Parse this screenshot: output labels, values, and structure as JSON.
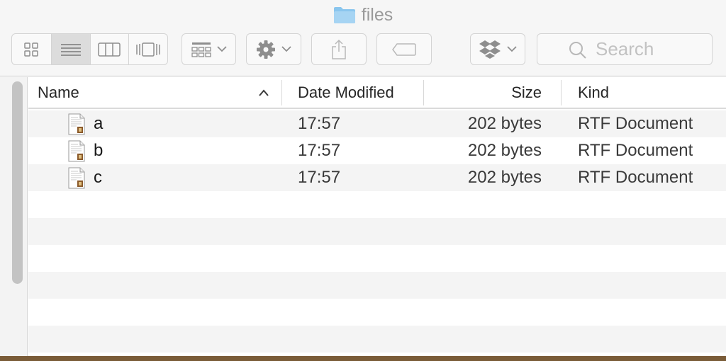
{
  "window": {
    "title": "files"
  },
  "toolbar": {
    "view_modes": [
      "icon-view",
      "list-view",
      "column-view",
      "cover-flow-view"
    ],
    "active_view": "list-view",
    "search_placeholder": "Search"
  },
  "columns": {
    "name": "Name",
    "date": "Date Modified",
    "size": "Size",
    "kind": "Kind",
    "sort_indicator": "^"
  },
  "files": [
    {
      "name": "a",
      "date": "17:57",
      "size": "202 bytes",
      "kind": "RTF Document"
    },
    {
      "name": "b",
      "date": "17:57",
      "size": "202 bytes",
      "kind": "RTF Document"
    },
    {
      "name": "c",
      "date": "17:57",
      "size": "202 bytes",
      "kind": "RTF Document"
    }
  ],
  "colors": {
    "folder": "#8ac6ee",
    "active_segment": "#dcdcdc",
    "alt_row": "#f4f4f4"
  }
}
